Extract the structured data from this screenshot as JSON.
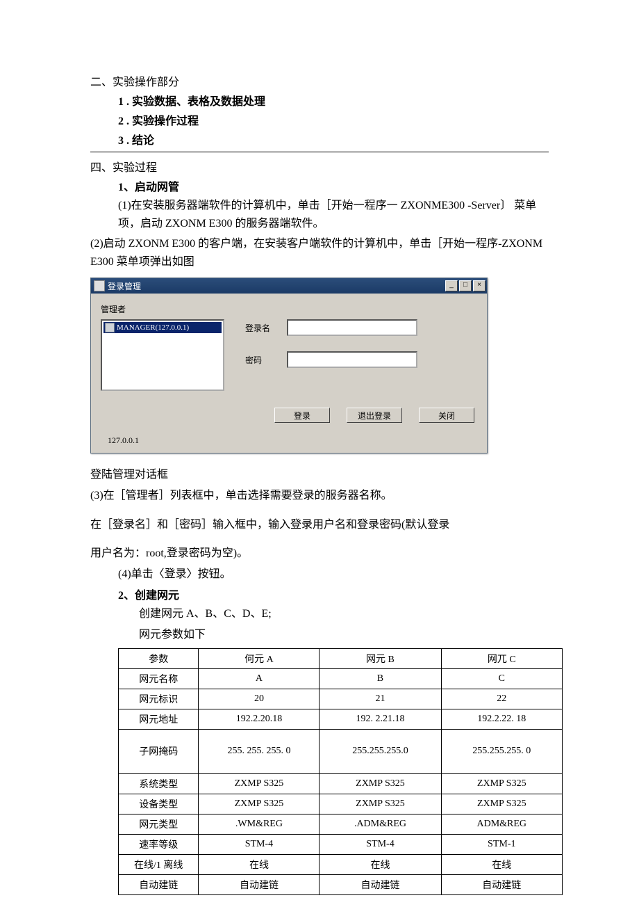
{
  "section2": {
    "title": "二、实验操作部分",
    "items": [
      "1 . 实验数据、表格及数据处理",
      "2 . 实验操作过程",
      "3 . 结论"
    ]
  },
  "section4": {
    "title": "四、实验过程",
    "step1_title": "1、启动网管",
    "step1_a": "(1)在安装服务器端软件的计算机中，单击［开始一程序一 ZXONME300 -Server〕 菜单项，启动 ZXONM E300 的服务器端软件。",
    "step1_b": "(2)启动 ZXONM E300 的客户端，在安装客户端软件的计算机中，单击［开始一程序-ZXONM E300 菜单项弹出如图"
  },
  "dialog": {
    "title": "登录管理",
    "manager_label": "管理者",
    "list_item": "MANAGER(127.0.0.1)",
    "login_label": "登录名",
    "login_value": "",
    "password_label": "密码",
    "password_value": "",
    "btn_login": "登录",
    "btn_logout": "退出登录",
    "btn_close": "关闭",
    "status": "127.0.0.1"
  },
  "after_dialog": {
    "l1": "登陆管理对话框",
    "l2": "(3)在［管理者］列表框中，单击选择需要登录的服务器名称。",
    "l3": "在［登录名］和［密码］输入框中，输入登录用户名和登录密码(默认登录",
    "l4": "用户名为：root,登录密码为空)。",
    "l5": "(4)单击〈登录〉按钮。",
    "step2_title": "2、创建网元",
    "step2_a": "创建网元 A、B、C、D、E;",
    "step2_b": "网元参数如下"
  },
  "table": {
    "headers": [
      "参数",
      "何元 A",
      "网元 B",
      "网兀 C"
    ],
    "rows": [
      [
        "网元名称",
        "A",
        "B",
        "C"
      ],
      [
        "网元标识",
        "20",
        "21",
        "22"
      ],
      [
        "网元地址",
        "192.2.20.18",
        "192. 2.21.18",
        "192.2.22. 18"
      ],
      [
        "子网掩码",
        "255. 255. 255. 0",
        "255.255.255.0",
        "255.255.255. 0"
      ],
      [
        "系统类型",
        "ZXMP S325",
        "ZXMP S325",
        "ZXMP S325"
      ],
      [
        "设备类型",
        "ZXMP S325",
        "ZXMP S325",
        "ZXMP S325"
      ],
      [
        "网元类型",
        ".WM&REG",
        ".ADM&REG",
        "ADM&REG"
      ],
      [
        "速率等级",
        "STM-4",
        "STM-4",
        "STM-1"
      ],
      [
        "在线/1 离线",
        "在线",
        "在线",
        "在线"
      ],
      [
        "自动建链",
        "自动建链",
        "自动建链",
        "自动建链"
      ]
    ]
  }
}
